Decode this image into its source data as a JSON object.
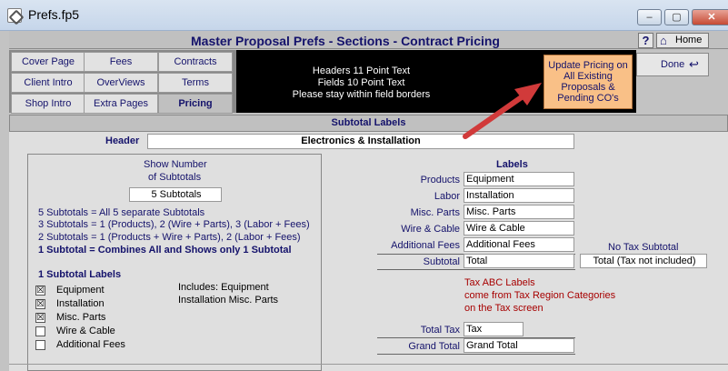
{
  "window": {
    "title": "Prefs.fp5",
    "min": "–",
    "max": "▢",
    "close": "✕"
  },
  "header": {
    "title": "Master Proposal Prefs - Sections - Contract Pricing",
    "help": "?",
    "home": "Home"
  },
  "nav": [
    {
      "label": "Cover Page"
    },
    {
      "label": "Fees"
    },
    {
      "label": "Contracts"
    },
    {
      "label": "Client Intro"
    },
    {
      "label": "OverViews"
    },
    {
      "label": "Terms"
    },
    {
      "label": "Shop Intro"
    },
    {
      "label": "Extra Pages"
    },
    {
      "label": "Pricing"
    }
  ],
  "info": [
    "Headers 11 Point Text",
    "Fields 10 Point Text",
    "Please stay within field borders"
  ],
  "update_button": "Update Pricing on All Existing Proposals & Pending CO's",
  "done_button": "Done",
  "section_title": "Subtotal Labels",
  "header_field": {
    "label": "Header",
    "value": "Electronics & Installation"
  },
  "subtotals": {
    "title1": "Show Number",
    "title2": "of Subtotals",
    "value": "5 Subtotals",
    "options": [
      "5  Subtotals = All 5 separate Subtotals",
      "3  Subtotals = 1 (Products),  2 (Wire + Parts),  3 (Labor + Fees)",
      "2  Subtotals = 1 (Products + Wire + Parts),  2 (Labor + Fees)",
      "1  Subtotal   = Combines All and Shows only 1 Subtotal"
    ],
    "one_title": "1 Subtotal Labels",
    "checks": [
      {
        "label": "Equipment",
        "checked": "☒"
      },
      {
        "label": "Installation",
        "checked": "☒"
      },
      {
        "label": "Misc. Parts",
        "checked": "☒"
      },
      {
        "label": "Wire & Cable",
        "checked": ""
      },
      {
        "label": "Additional Fees",
        "checked": ""
      }
    ],
    "includes1": "Includes: Equipment",
    "includes2": "Installation  Misc. Parts"
  },
  "labels": {
    "title": "Labels",
    "rows": [
      {
        "label": "Products",
        "value": "Equipment"
      },
      {
        "label": "Labor",
        "value": "Installation"
      },
      {
        "label": "Misc. Parts",
        "value": "Misc. Parts"
      },
      {
        "label": "Wire & Cable",
        "value": "Wire & Cable"
      },
      {
        "label": "Additional Fees",
        "value": "Additional Fees"
      }
    ],
    "subtotal": {
      "label": "Subtotal",
      "value": "Total"
    },
    "no_tax_title": "No Tax Subtotal",
    "no_tax_value": "Total (Tax not included)",
    "tax_note": [
      "Tax ABC Labels",
      "come from Tax Region Categories",
      "on the Tax screen"
    ],
    "total_tax": {
      "label": "Total Tax",
      "value": "Tax"
    },
    "grand_total": {
      "label": "Grand Total",
      "value": "Grand Total"
    }
  },
  "colors": {
    "navy": "#14126b",
    "update_bg": "#f9c087",
    "arrow": "#d13a3a",
    "note_red": "#a70000"
  }
}
